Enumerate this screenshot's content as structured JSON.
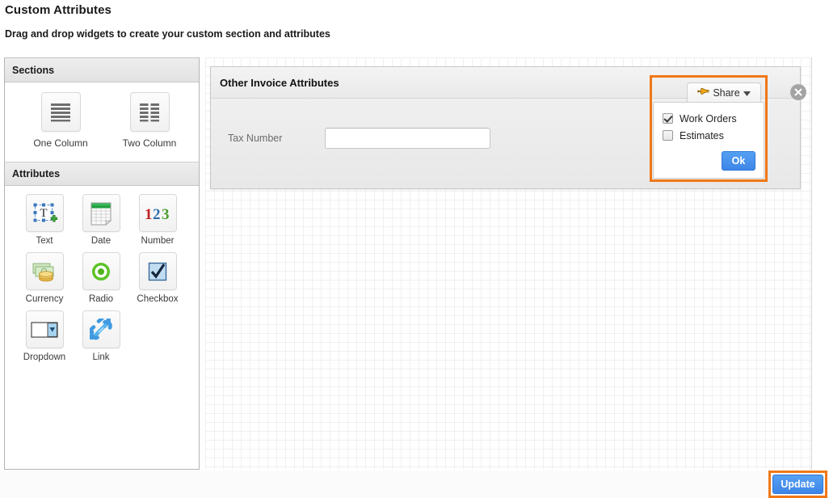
{
  "header": {
    "title": "Custom Attributes",
    "subtitle": "Drag and drop widgets to create your custom section and attributes"
  },
  "sidebar": {
    "sections_panel": {
      "title": "Sections",
      "widgets": [
        {
          "label": "One Column",
          "icon": "one-column-icon"
        },
        {
          "label": "Two Column",
          "icon": "two-column-icon"
        }
      ]
    },
    "attributes_panel": {
      "title": "Attributes",
      "widgets": [
        {
          "label": "Text",
          "icon": "text-widget-icon"
        },
        {
          "label": "Date",
          "icon": "date-widget-icon"
        },
        {
          "label": "Number",
          "icon": "number-widget-icon"
        },
        {
          "label": "Currency",
          "icon": "currency-widget-icon"
        },
        {
          "label": "Radio",
          "icon": "radio-widget-icon"
        },
        {
          "label": "Checkbox",
          "icon": "checkbox-widget-icon"
        },
        {
          "label": "Dropdown",
          "icon": "dropdown-widget-icon"
        },
        {
          "label": "Link",
          "icon": "link-widget-icon"
        }
      ]
    }
  },
  "canvas": {
    "section": {
      "title": "Other Invoice Attributes",
      "close_icon": "close-icon",
      "fields": [
        {
          "label": "Tax Number",
          "value": "",
          "placeholder": ""
        }
      ]
    },
    "share": {
      "button_label": "Share",
      "button_icon": "pointing-hand-icon",
      "caret_icon": "chevron-down-icon",
      "options": [
        {
          "label": "Work Orders",
          "checked": true
        },
        {
          "label": "Estimates",
          "checked": false
        }
      ],
      "ok_label": "Ok",
      "highlight_color": "#f07818"
    }
  },
  "footer": {
    "update_label": "Update",
    "highlight_color": "#f07818"
  },
  "colors": {
    "accent_blue": "#3d86e8",
    "highlight_orange": "#f07818",
    "panel_gray": "#e7e7e7"
  }
}
